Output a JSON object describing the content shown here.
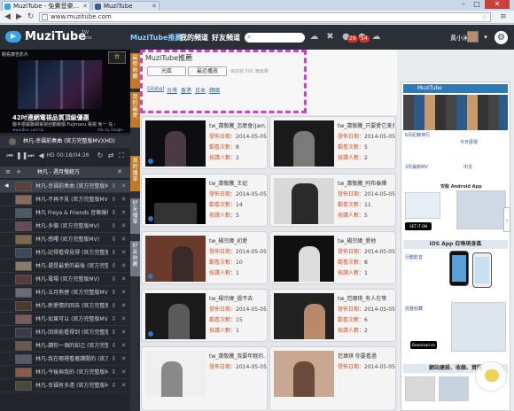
{
  "browser": {
    "tabs": [
      {
        "title": "MuziTube - 免費音樂..."
      },
      {
        "title": "MuziTube"
      }
    ],
    "url": "www.muzitube.com"
  },
  "site": {
    "brand": "MuziTube",
    "brand_tw": "TW",
    "brand_beta": "Beta",
    "nav": [
      "MuziTube推薦",
      "我的頻道",
      "好友頻道"
    ],
    "notifications": {
      "messages": "26",
      "alerts": "54"
    },
    "username": "黃小米"
  },
  "ad": {
    "label": "觀看廣告影片",
    "logo": "台",
    "title": "42吋連網電視品質頂級優惠",
    "subtitle": "聯手搭載聯網電視自動報價 Fujimaru 電視 免一 充 ›",
    "url": "www.tbcc.com.tw",
    "adchoice": "Ads by Google"
  },
  "player": {
    "now_playing": "林凡-幸福前奏曲 (官方完整版MV)(HD)",
    "timecode": "00:18/04:26",
    "hd_label": "HD",
    "playlist_title": "林凡 - 週月慢經万",
    "items": [
      "林凡-幸福前奏曲 (官方完整版MV)",
      "林凡-不再不見 (官方完整版MV)",
      "林凡 Freya & Friends 音樂爆炸日",
      "林凡-多傷 (官方完整版MV)",
      "林凡-感曙 (官方完整版MV)",
      "林凡-記得看得見得 (官方完整版MV)",
      "林凡-還是最愛的最後 (官方完整版MV)",
      "林凡-電場 (官方完整版MV)",
      "林凡-五月熊煙 (官方完整版MV)",
      "林凡-新愛情的回去 (官方完整版MV)",
      "林凡-如果可以 (官方完整版MV)",
      "林凡-回來能看得到 (官方完整版MV)",
      "林凡-讀你一個的知己 (官方完整版MV)",
      "林凡-我在哪裡看著讀開的 (官方完整版MV)",
      "林凡-今後與我的 (官方完整版MV)",
      "林凡-幸福有多遠 (官方完整版MV)"
    ]
  },
  "vtabs": [
    "最新收藏",
    "我的最愛",
    "我的播單",
    "好友播單",
    "好友收藏"
  ],
  "main": {
    "title": "MuziTube推薦",
    "buttons": [
      "光區",
      "最近播放"
    ],
    "count_text": "目前有 501 筆結果",
    "filters": [
      "Global",
      "台灣",
      "香港",
      "日本",
      "韓國"
    ],
    "field_labels": {
      "date": "發佈日期：",
      "views": "觀看次數：",
      "fans": "按讚人數："
    },
    "cards": [
      {
        "title": "tw_蕭敬騰_怎麼會(Jam...",
        "date": "2014-05-05",
        "views": "8",
        "fans": "2"
      },
      {
        "title": "tw_蕭敬騰_只要愛它美女",
        "date": "2014-05-05",
        "views": "5",
        "fans": "2"
      },
      {
        "title": "tw_蕭敬騰_王妃",
        "date": "2014-05-05",
        "views": "14",
        "fans": "5"
      },
      {
        "title": "tw_蕭敬騰_阿布泰繹",
        "date": "2014-05-05",
        "views": "11",
        "fans": "5"
      },
      {
        "title": "tw_楊宗緯_初愛",
        "date": "2014-05-05",
        "views": "10",
        "fans": "1"
      },
      {
        "title": "tw_楊宗緯_愛他",
        "date": "2014-05-05",
        "views": "8",
        "fans": "1"
      },
      {
        "title": "tw_楊宗緯_過不去",
        "date": "2014-05-05",
        "views": "15",
        "fans": "1"
      },
      {
        "title": "tw_范瑋琪_有人在等",
        "date": "2014-05-05",
        "views": "6",
        "fans": "2"
      },
      {
        "title": "tw_蕭敬騰_我要年輕的...",
        "date": "2014-05-05",
        "views": "",
        "fans": ""
      },
      {
        "title": "范瑋琪 你要看過",
        "date": "2014-05-05",
        "views": "",
        "fans": ""
      }
    ]
  },
  "right": {
    "header": "MuziTube",
    "lines": [
      "6月紀錄排行",
      "今日發現",
      "3月最新MV",
      "中文"
    ],
    "android_title": "安裝 Android App",
    "google_play": "GET IT ON Google play",
    "ios_title": "iOS App 召喚現身區",
    "ios_links": [
      "行動影音",
      "完整收藏"
    ],
    "app_store": "Download on the App Store",
    "bottom_title": "網站建設、收錄、資訊"
  },
  "colors": {
    "accent": "#c07a28",
    "highlight": "#d43cd6",
    "header": "#2b2f36"
  }
}
